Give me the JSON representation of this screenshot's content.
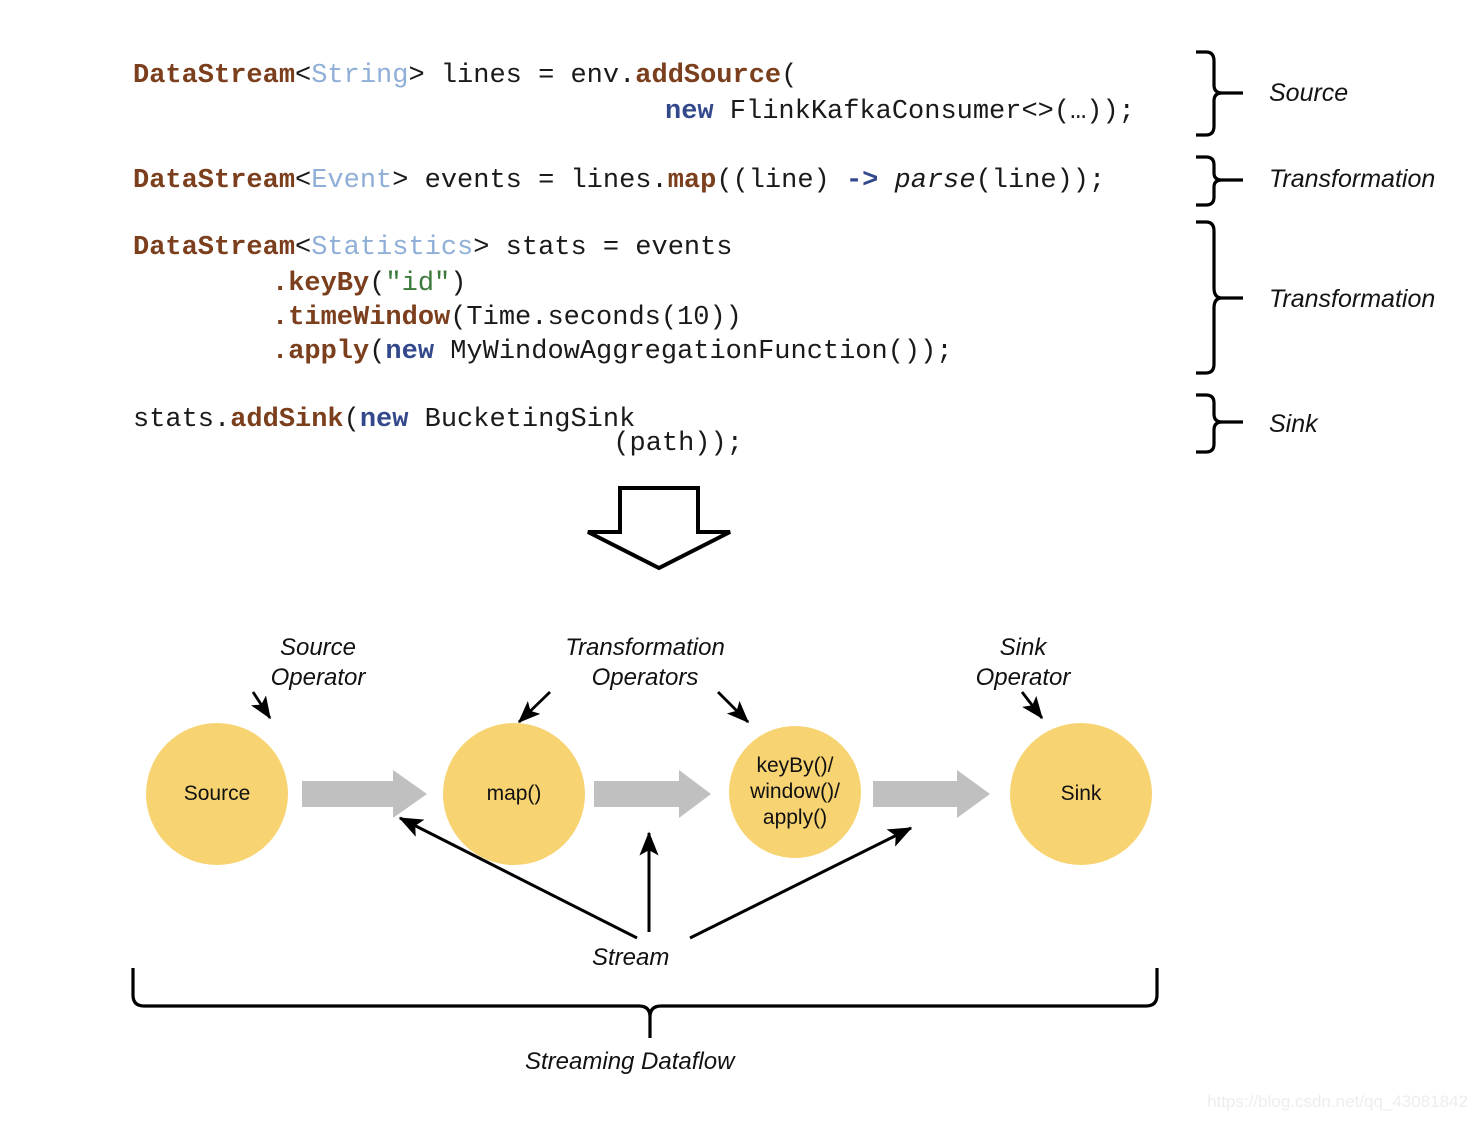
{
  "code": {
    "lines": [
      {
        "id": "line-1",
        "tokens": [
          {
            "t": "DataStream",
            "c": "kw-type"
          },
          {
            "t": "<",
            "c": "plain"
          },
          {
            "t": "String",
            "c": "generic"
          },
          {
            "t": "> lines = env.",
            "c": "plain"
          },
          {
            "t": "addSource",
            "c": "method"
          },
          {
            "t": "(",
            "c": "plain"
          }
        ]
      },
      {
        "id": "line-2",
        "tokens": [
          {
            "t": "new",
            "c": "kw-new"
          },
          {
            "t": " FlinkKafkaConsumer<>(…));",
            "c": "plain"
          }
        ]
      },
      {
        "id": "line-3",
        "tokens": [
          {
            "t": "DataStream",
            "c": "kw-type"
          },
          {
            "t": "<",
            "c": "plain"
          },
          {
            "t": "Event",
            "c": "generic"
          },
          {
            "t": "> events = lines.",
            "c": "plain"
          },
          {
            "t": "map",
            "c": "method"
          },
          {
            "t": "((line) ",
            "c": "plain"
          },
          {
            "t": "->",
            "c": "arrow-op"
          },
          {
            "t": " ",
            "c": "plain"
          },
          {
            "t": "parse",
            "c": "ital"
          },
          {
            "t": "(line));",
            "c": "plain"
          }
        ]
      },
      {
        "id": "line-4",
        "tokens": [
          {
            "t": "DataStream",
            "c": "kw-type"
          },
          {
            "t": "<",
            "c": "plain"
          },
          {
            "t": "Statistics",
            "c": "generic"
          },
          {
            "t": "> stats = events",
            "c": "plain"
          }
        ]
      },
      {
        "id": "line-5",
        "tokens": [
          {
            "t": ".",
            "c": "method"
          },
          {
            "t": "keyBy",
            "c": "method"
          },
          {
            "t": "(",
            "c": "plain"
          },
          {
            "t": "\"id\"",
            "c": "str"
          },
          {
            "t": ")",
            "c": "plain"
          }
        ]
      },
      {
        "id": "line-6",
        "tokens": [
          {
            "t": ".",
            "c": "method"
          },
          {
            "t": "timeWindow",
            "c": "method"
          },
          {
            "t": "(Time.seconds(10))",
            "c": "plain"
          }
        ]
      },
      {
        "id": "line-7",
        "tokens": [
          {
            "t": ".",
            "c": "method"
          },
          {
            "t": "apply",
            "c": "method"
          },
          {
            "t": "(",
            "c": "plain"
          },
          {
            "t": "new",
            "c": "kw-new"
          },
          {
            "t": " MyWindowAggregationFunction());",
            "c": "plain"
          }
        ]
      },
      {
        "id": "line-8",
        "tokens": [
          {
            "t": "stats.",
            "c": "plain"
          },
          {
            "t": "addSink",
            "c": "method"
          },
          {
            "t": "(",
            "c": "plain"
          },
          {
            "t": "new",
            "c": "kw-new"
          },
          {
            "t": " BucketingSink",
            "c": "plain"
          }
        ],
        "overlap": "(path));"
      }
    ]
  },
  "brace_labels": [
    {
      "id": "source",
      "text": "Source"
    },
    {
      "id": "transformation-1",
      "text": "Transformation"
    },
    {
      "id": "transformation-2",
      "text": "Transformation"
    },
    {
      "id": "sink",
      "text": "Sink"
    }
  ],
  "diagram": {
    "nodes": [
      {
        "id": "source",
        "label": "Source"
      },
      {
        "id": "map",
        "label": "map()"
      },
      {
        "id": "keyby-window-apply",
        "label": "keyBy()/\nwindow()/\napply()"
      },
      {
        "id": "sink",
        "label": "Sink"
      }
    ],
    "annotations": [
      {
        "id": "source-operator",
        "text": "Source\nOperator"
      },
      {
        "id": "transformation-operators",
        "text": "Transformation\nOperators"
      },
      {
        "id": "sink-operator",
        "text": "Sink\nOperator"
      }
    ],
    "stream_label": "Stream",
    "dataflow_label": "Streaming Dataflow"
  },
  "watermark": {
    "text": "https://blog.csdn.net/qq_43081842"
  },
  "colors": {
    "node_fill": "#F7D372",
    "flow_arrow": "#C0C0C0",
    "code_type": "#7B3F1D",
    "code_generic": "#8FAFD8",
    "code_keyword": "#33498C",
    "code_string": "#3C7A3C",
    "stroke": "#000000"
  }
}
